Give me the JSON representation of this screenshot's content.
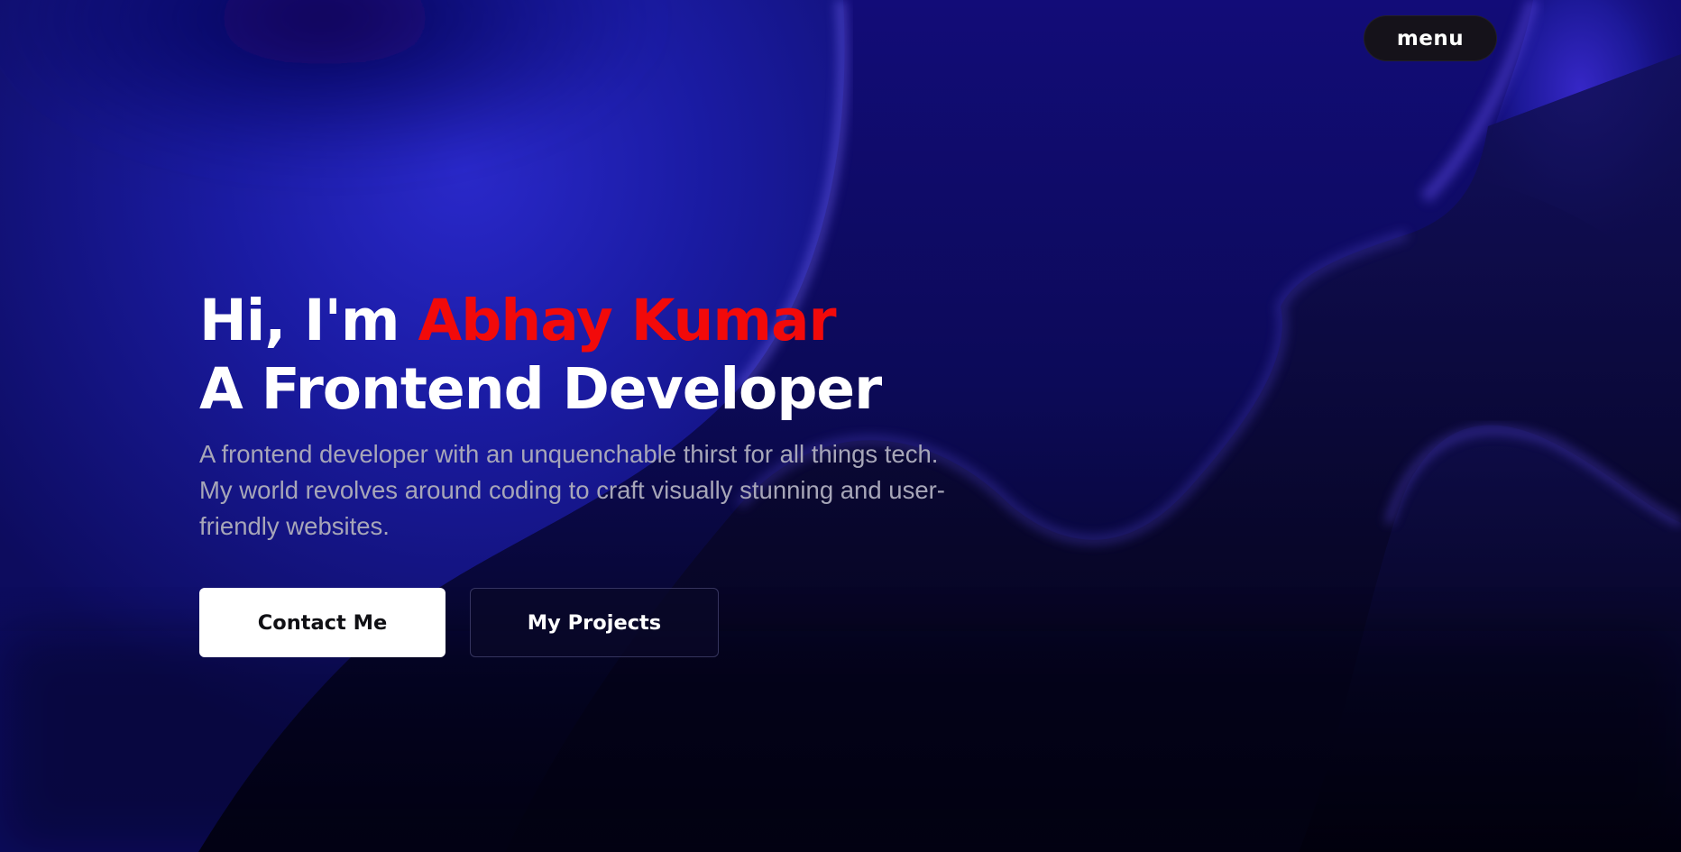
{
  "nav": {
    "menu_label": "menu"
  },
  "hero": {
    "greeting": "Hi, I'm",
    "name": "Abhay Kumar",
    "role": "A Frontend Developer",
    "description": "A frontend developer with an unquenchable thirst for all things tech. My world revolves around coding to craft visually stunning and user-friendly websites.",
    "primary_button": "Contact Me",
    "secondary_button": "My Projects"
  },
  "colors": {
    "accent_name": "#f20a0a",
    "background_deep": "#05031a",
    "background_blue": "#1a1ea0",
    "highlight_violet": "#4a2ad8"
  }
}
